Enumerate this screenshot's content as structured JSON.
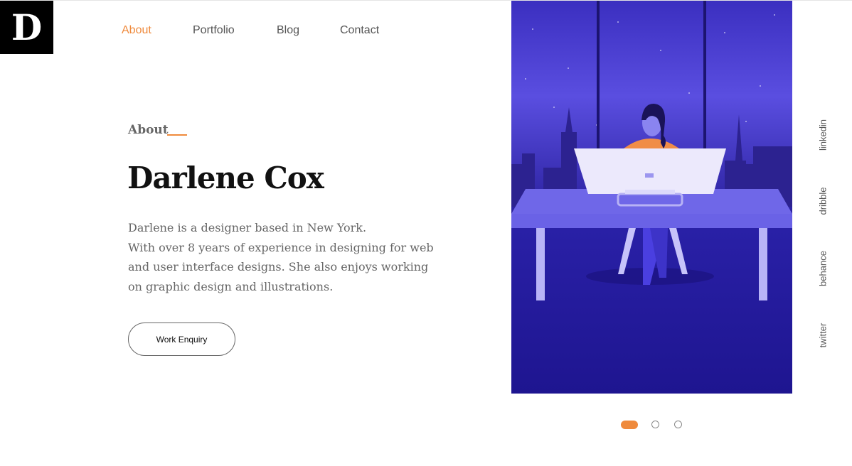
{
  "logo": {
    "letter": "D"
  },
  "nav": {
    "items": [
      "About",
      "Portfolio",
      "Blog",
      "Contact"
    ],
    "active": "About"
  },
  "about": {
    "section_label": "About",
    "name": "Darlene Cox",
    "bio_lines": [
      "Darlene is a designer based in New York.",
      "With over 8 years of experience in designing for web",
      "and user interface designs. She also enjoys working",
      "on graphic design and illustrations."
    ],
    "cta_label": "Work Enquiry"
  },
  "social": [
    "linkedin",
    "dribble",
    "behance",
    "twitter"
  ],
  "slider": {
    "count": 3,
    "active_index": 0
  },
  "colors": {
    "accent": "#ef8a3c",
    "text_dark": "#111111",
    "text_muted": "#666666",
    "illustration_bg": "#3a2fbf"
  },
  "illustration": {
    "subject": "woman working at a computer desk with New York skyline at night"
  }
}
